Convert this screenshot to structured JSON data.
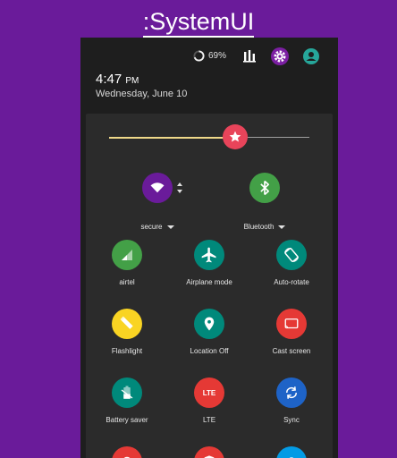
{
  "app": {
    "title": ":SystemUI"
  },
  "statusbar": {
    "battery_percent": "69%",
    "battery_level": 0.69,
    "icons": [
      "battery-ring-icon",
      "equalizer-icon",
      "settings-gear-icon",
      "account-icon"
    ]
  },
  "clock": {
    "time": "4:47",
    "ampm": "PM",
    "date": "Wednesday, June 10"
  },
  "brightness": {
    "level": 0.6
  },
  "big_tiles": [
    {
      "name": "wifi",
      "label": "secure",
      "icon": "wifi-icon",
      "color": "#6a1b9a"
    },
    {
      "name": "bluetooth",
      "label": "Bluetooth",
      "icon": "bluetooth-icon",
      "color": "#43a047"
    }
  ],
  "tiles": [
    {
      "label": "airtel",
      "icon": "signal-icon",
      "color": "#43a047"
    },
    {
      "label": "Airplane mode",
      "icon": "airplane-icon",
      "color": "#00897b"
    },
    {
      "label": "Auto-rotate",
      "icon": "rotate-icon",
      "color": "#00897b"
    },
    {
      "label": "Flashlight",
      "icon": "flashlight-icon",
      "color": "#f9d423"
    },
    {
      "label": "Location Off",
      "icon": "location-icon",
      "color": "#00897b"
    },
    {
      "label": "Cast screen",
      "icon": "cast-icon",
      "color": "#e53935"
    },
    {
      "label": "Battery saver",
      "icon": "battery-saver-icon",
      "color": "#00897b"
    },
    {
      "label": "LTE",
      "icon": "lte-icon",
      "color": "#e53935",
      "glyph": "LTE"
    },
    {
      "label": "Sync",
      "icon": "sync-icon",
      "color": "#1e63c7"
    }
  ],
  "partial_tiles": [
    {
      "icon": "hotspot-icon",
      "color": "#e53935"
    },
    {
      "icon": "shield-icon",
      "color": "#e53935"
    },
    {
      "icon": "camera-icon",
      "color": "#039be5"
    }
  ]
}
